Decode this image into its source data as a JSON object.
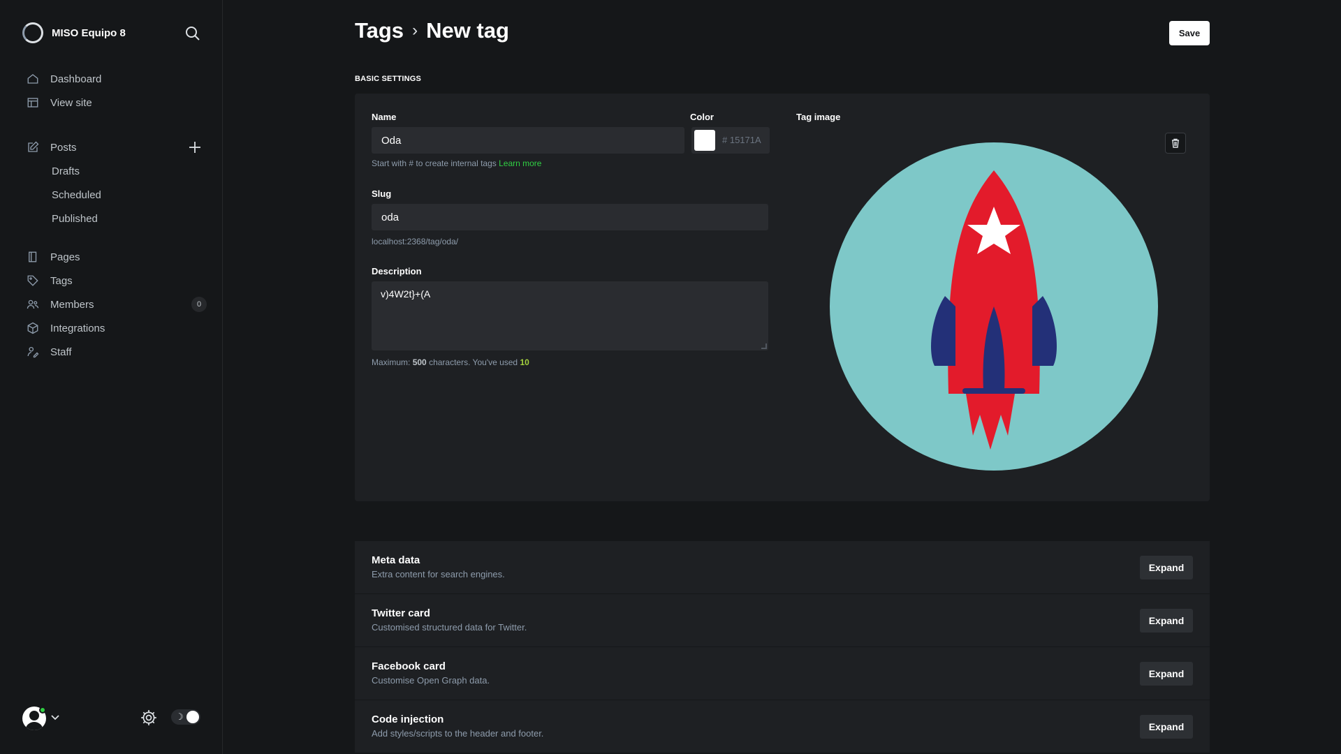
{
  "sidebar": {
    "site_name": "MISO Equipo 8",
    "nav_main": [
      {
        "label": "Dashboard",
        "icon": "home-icon"
      },
      {
        "label": "View site",
        "icon": "layout-icon"
      }
    ],
    "posts": {
      "label": "Posts",
      "icon": "edit-icon"
    },
    "posts_sub": [
      "Drafts",
      "Scheduled",
      "Published"
    ],
    "nav_secondary": [
      {
        "label": "Pages",
        "icon": "page-icon"
      },
      {
        "label": "Tags",
        "icon": "tag-icon"
      },
      {
        "label": "Members",
        "icon": "members-icon",
        "count": "0"
      },
      {
        "label": "Integrations",
        "icon": "integrations-icon"
      },
      {
        "label": "Staff",
        "icon": "staff-icon"
      }
    ]
  },
  "header": {
    "breadcrumb_parent": "Tags",
    "page_title": "New tag",
    "save_label": "Save"
  },
  "basic": {
    "section_label": "BASIC SETTINGS",
    "name_label": "Name",
    "name_value": "Oda",
    "name_hint": "Start with # to create internal tags",
    "learn_more": "Learn more",
    "color_label": "Color",
    "color_hash": "#",
    "color_value": "15171A",
    "slug_label": "Slug",
    "slug_value": "oda",
    "slug_url": "localhost:2368/tag/oda/",
    "description_label": "Description",
    "description_value": "v)4W2t}+(A",
    "desc_hint_prefix": "Maximum:",
    "desc_max": "500",
    "desc_hint_mid": "characters. You've used",
    "desc_used": "10",
    "tag_image_label": "Tag image"
  },
  "accordion": [
    {
      "title": "Meta data",
      "desc": "Extra content for search engines.",
      "button": "Expand"
    },
    {
      "title": "Twitter card",
      "desc": "Customised structured data for Twitter.",
      "button": "Expand"
    },
    {
      "title": "Facebook card",
      "desc": "Customise Open Graph data.",
      "button": "Expand"
    },
    {
      "title": "Code injection",
      "desc": "Add styles/scripts to the header and footer.",
      "button": "Expand"
    }
  ],
  "colors": {
    "accent_green": "#30cf43",
    "rocket_bg": "#7ec8c8",
    "rocket_red": "#e31b2b",
    "rocket_blue": "#233078"
  }
}
